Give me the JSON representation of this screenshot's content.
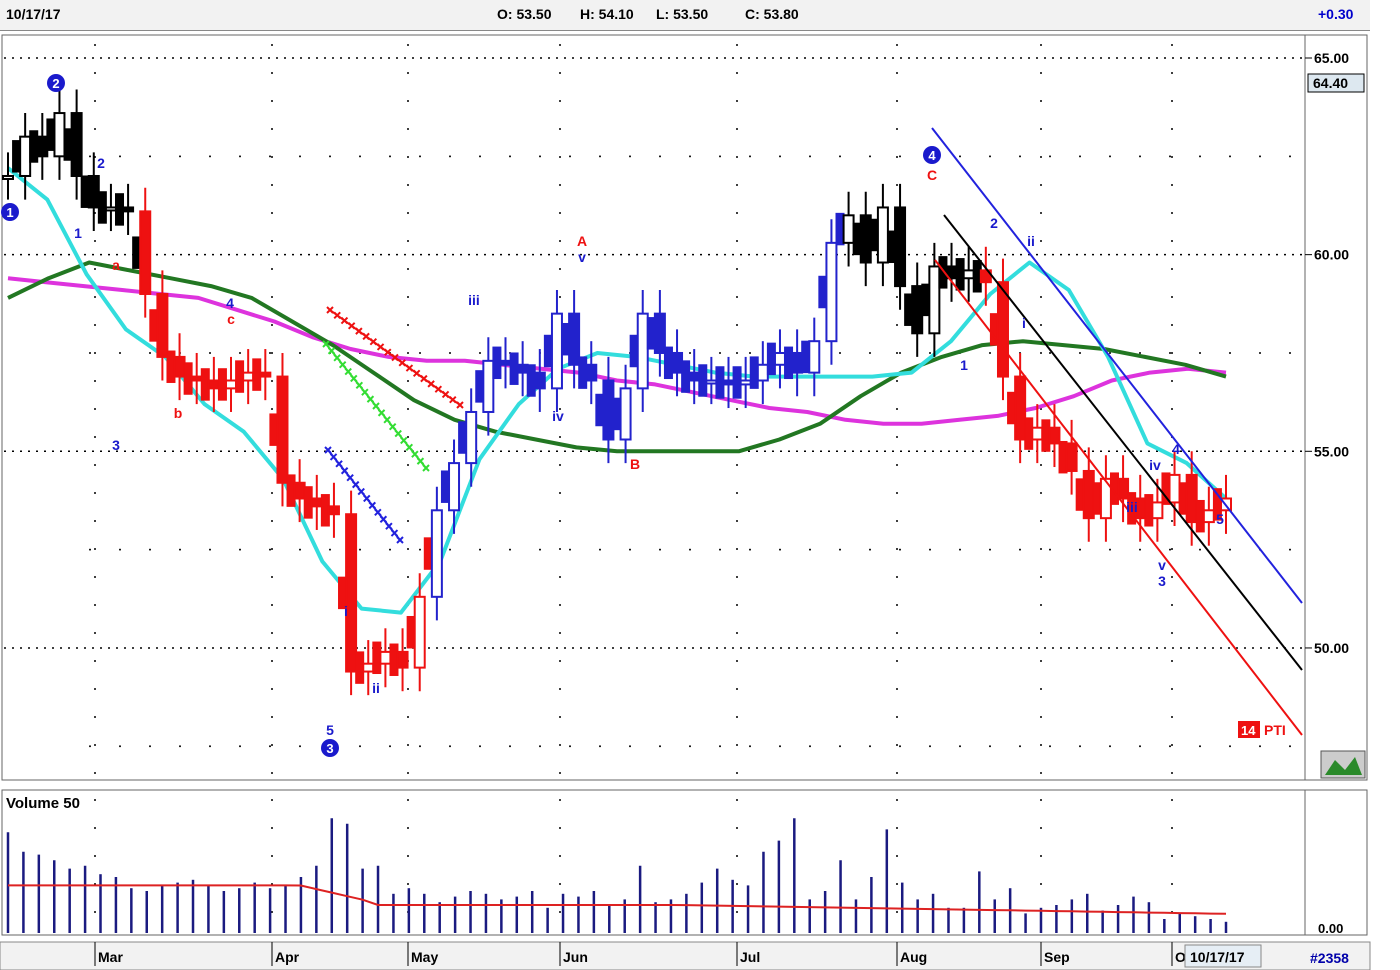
{
  "header": {
    "date": "10/17/17",
    "open": "O: 53.50",
    "high": "H: 54.10",
    "low": "L: 53.50",
    "close": "C: 53.80",
    "change": "+0.30"
  },
  "price_panel": {
    "last_price_tag": "64.40",
    "pti_value": "14",
    "pti_label": "PTI"
  },
  "volume_panel": {
    "title": "Volume 50",
    "axis_label": "0.00"
  },
  "footer": {
    "date_box": "10/17/17",
    "symbol_count": "#2358"
  },
  "colors": {
    "up_trend": "#2222cc",
    "down_trend": "#ee1111",
    "neutral": "#000000",
    "ma_cyan": "#33dddd",
    "ma_magenta": "#dd33dd",
    "ma_green": "#227722",
    "volume_bars": "#1a1a80",
    "volume_avg": "#dd2222"
  },
  "chart_data": {
    "type": "candlestick",
    "y_ticks": [
      "65.00",
      "60.00",
      "55.00",
      "50.00"
    ],
    "ylim": [
      46.6,
      65.5
    ],
    "x_ticks": [
      "Mar",
      "Apr",
      "May",
      "Jun",
      "Jul",
      "Aug",
      "Sep",
      "O"
    ],
    "waves_primary": [
      {
        "label": "1",
        "x": "Feb 2",
        "y": 61.1
      },
      {
        "label": "2",
        "x": "Feb 13",
        "y": 64.4
      },
      {
        "label": "3",
        "x": "Apr 14",
        "y": 46.9
      },
      {
        "label": "4",
        "x": "Aug 9",
        "y": 62.5
      }
    ],
    "wave_labels_blue": [
      "1",
      "2",
      "3",
      "4",
      "5",
      "i",
      "ii",
      "iii",
      "iv",
      "v",
      "1",
      "2",
      "i",
      "ii",
      "iii",
      "iv",
      "v",
      "3",
      "4",
      "5"
    ],
    "wave_labels_red": [
      "a",
      "b",
      "c",
      "A",
      "B",
      "C"
    ],
    "price_series": [
      {
        "d": "Feb 1",
        "v": 62.0
      },
      {
        "d": "Feb 6",
        "v": 63.0
      },
      {
        "d": "Feb 10",
        "v": 62.5
      },
      {
        "d": "Feb 14",
        "v": 63.6
      },
      {
        "d": "Feb 17",
        "v": 62.0
      },
      {
        "d": "Feb 21",
        "v": 61.2
      },
      {
        "d": "Feb 24",
        "v": 61.2
      },
      {
        "d": "Feb 28",
        "v": 61.1
      },
      {
        "d": "Mar 1",
        "v": 59.0
      },
      {
        "d": "Mar 3",
        "v": 57.4
      },
      {
        "d": "Mar 7",
        "v": 56.9
      },
      {
        "d": "Mar 10",
        "v": 56.8
      },
      {
        "d": "Mar 15",
        "v": 56.6
      },
      {
        "d": "Mar 20",
        "v": 56.8
      },
      {
        "d": "Mar 24",
        "v": 57.0
      },
      {
        "d": "Mar 28",
        "v": 56.9
      },
      {
        "d": "Mar 31",
        "v": 54.2
      },
      {
        "d": "Apr 3",
        "v": 53.8
      },
      {
        "d": "Apr 7",
        "v": 53.6
      },
      {
        "d": "Apr 11",
        "v": 53.4
      },
      {
        "d": "Apr 13",
        "v": 49.4
      },
      {
        "d": "Apr 17",
        "v": 49.6
      },
      {
        "d": "Apr 20",
        "v": 49.9
      },
      {
        "d": "Apr 25",
        "v": 49.5
      },
      {
        "d": "Apr 28",
        "v": 51.3
      },
      {
        "d": "May 2",
        "v": 53.5
      },
      {
        "d": "May 4",
        "v": 54.7
      },
      {
        "d": "May 8",
        "v": 56.0
      },
      {
        "d": "May 12",
        "v": 57.3
      },
      {
        "d": "May 16",
        "v": 57.2
      },
      {
        "d": "May 20",
        "v": 57.0
      },
      {
        "d": "May 24",
        "v": 56.6
      },
      {
        "d": "May 31",
        "v": 58.5
      },
      {
        "d": "Jun 5",
        "v": 57.2
      },
      {
        "d": "Jun 9",
        "v": 56.8
      },
      {
        "d": "Jun 13",
        "v": 55.3
      },
      {
        "d": "Jun 16",
        "v": 56.6
      },
      {
        "d": "Jun 20",
        "v": 58.5
      },
      {
        "d": "Jun 23",
        "v": 57.5
      },
      {
        "d": "Jun 27",
        "v": 57.0
      },
      {
        "d": "Jun 30",
        "v": 56.8
      },
      {
        "d": "Jul 5",
        "v": 56.8
      },
      {
        "d": "Jul 10",
        "v": 56.7
      },
      {
        "d": "Jul 14",
        "v": 56.8
      },
      {
        "d": "Jul 18",
        "v": 57.2
      },
      {
        "d": "Jul 21",
        "v": 57.5
      },
      {
        "d": "Jul 25",
        "v": 57.0
      },
      {
        "d": "Jul 28",
        "v": 57.8
      },
      {
        "d": "Aug 1",
        "v": 60.3
      },
      {
        "d": "Aug 3",
        "v": 61.0
      },
      {
        "d": "Aug 7",
        "v": 59.8
      },
      {
        "d": "Aug 9",
        "v": 61.2
      },
      {
        "d": "Aug 11",
        "v": 59.2
      },
      {
        "d": "Aug 15",
        "v": 58.0
      },
      {
        "d": "Aug 18",
        "v": 59.7
      },
      {
        "d": "Aug 21",
        "v": 59.4
      },
      {
        "d": "Aug 24",
        "v": 59.6
      },
      {
        "d": "Aug 28",
        "v": 59.3
      },
      {
        "d": "Aug 31",
        "v": 56.9
      },
      {
        "d": "Sep 5",
        "v": 55.3
      },
      {
        "d": "Sep 8",
        "v": 55.6
      },
      {
        "d": "Sep 12",
        "v": 55.2
      },
      {
        "d": "Sep 15",
        "v": 54.5
      },
      {
        "d": "Sep 19",
        "v": 53.3
      },
      {
        "d": "Sep 22",
        "v": 54.3
      },
      {
        "d": "Sep 26",
        "v": 53.8
      },
      {
        "d": "Sep 29",
        "v": 53.3
      },
      {
        "d": "Oct 3",
        "v": 53.7
      },
      {
        "d": "Oct 6",
        "v": 54.4
      },
      {
        "d": "Oct 10",
        "v": 53.2
      },
      {
        "d": "Oct 13",
        "v": 53.5
      },
      {
        "d": "Oct 17",
        "v": 53.8
      }
    ],
    "moving_averages": {
      "cyan": [
        62.2,
        61.4,
        59.5,
        58.1,
        57.4,
        56.2,
        55.5,
        54.3,
        52.2,
        51.0,
        50.9,
        52.2,
        54.8,
        56.2,
        57.1,
        57.5,
        57.4,
        57.2,
        57.0,
        56.9,
        56.9,
        56.9,
        56.9,
        57.0,
        57.8,
        59.0,
        59.8,
        59.1,
        57.4,
        55.2,
        54.7,
        53.8
      ],
      "magenta": [
        59.4,
        59.3,
        59.2,
        59.1,
        59.0,
        58.9,
        58.6,
        58.3,
        57.9,
        57.6,
        57.4,
        57.3,
        57.3,
        57.2,
        57.1,
        57.0,
        56.8,
        56.7,
        56.5,
        56.3,
        56.1,
        56.0,
        55.8,
        55.7,
        55.7,
        55.8,
        55.9,
        56.1,
        56.4,
        56.8,
        57.0,
        57.1,
        57.0
      ],
      "green": [
        58.9,
        59.4,
        59.8,
        59.6,
        59.4,
        59.2,
        58.9,
        58.3,
        57.7,
        57.0,
        56.3,
        55.8,
        55.5,
        55.3,
        55.1,
        55.0,
        55.0,
        55.0,
        55.0,
        55.3,
        55.7,
        56.4,
        57.0,
        57.4,
        57.7,
        57.8,
        57.7,
        57.6,
        57.4,
        57.2,
        56.9
      ]
    },
    "volume": [
      36,
      29,
      28,
      26,
      23,
      24,
      21,
      20,
      16,
      15,
      17,
      18,
      19,
      17,
      15,
      16,
      18,
      16,
      17,
      20,
      24,
      41,
      39,
      23,
      24,
      14,
      16,
      14,
      11,
      13,
      15,
      14,
      12,
      13,
      15,
      9,
      14,
      13,
      15,
      10,
      12,
      24,
      11,
      12,
      14,
      18,
      23,
      19,
      17,
      29,
      33,
      41,
      12,
      15,
      26,
      12,
      20,
      37,
      18,
      12,
      14,
      9,
      9,
      22,
      12,
      16,
      7,
      9,
      10,
      12,
      14,
      8,
      10,
      13,
      11,
      5,
      7,
      6,
      5,
      4
    ]
  }
}
